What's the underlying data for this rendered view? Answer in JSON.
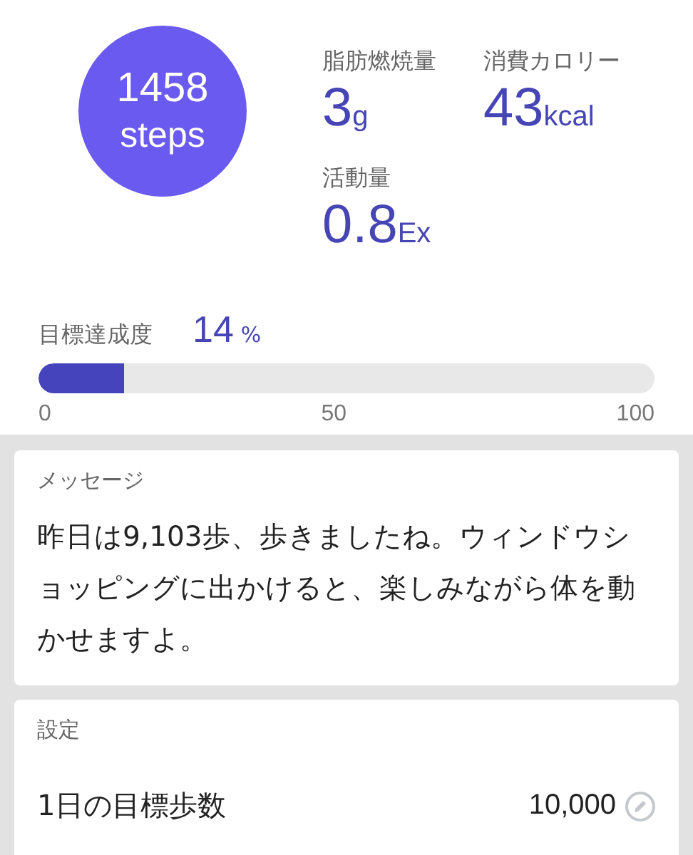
{
  "steps": {
    "value": "1458",
    "unit": "steps"
  },
  "stats": [
    {
      "label": "脂肪燃焼量",
      "value": "3",
      "unit": "g"
    },
    {
      "label": "消費カロリー",
      "value": "43",
      "unit": "kcal"
    },
    {
      "label": "活動量",
      "value": "0.8",
      "unit": "Ex"
    }
  ],
  "goal": {
    "label": "目標達成度",
    "value": "14",
    "unit": "%",
    "level": 0.14,
    "ticks": [
      "0",
      "50",
      "100"
    ]
  },
  "message": {
    "title": "メッセージ",
    "text": "昨日は9,103歩、歩きましたね。ウィンドウショッピングに出かけると、楽しみながら体を動かせますよ。"
  },
  "settings": {
    "title": "設定",
    "rows": [
      {
        "label": "1日の目標歩数",
        "value": "10,000"
      }
    ]
  }
}
